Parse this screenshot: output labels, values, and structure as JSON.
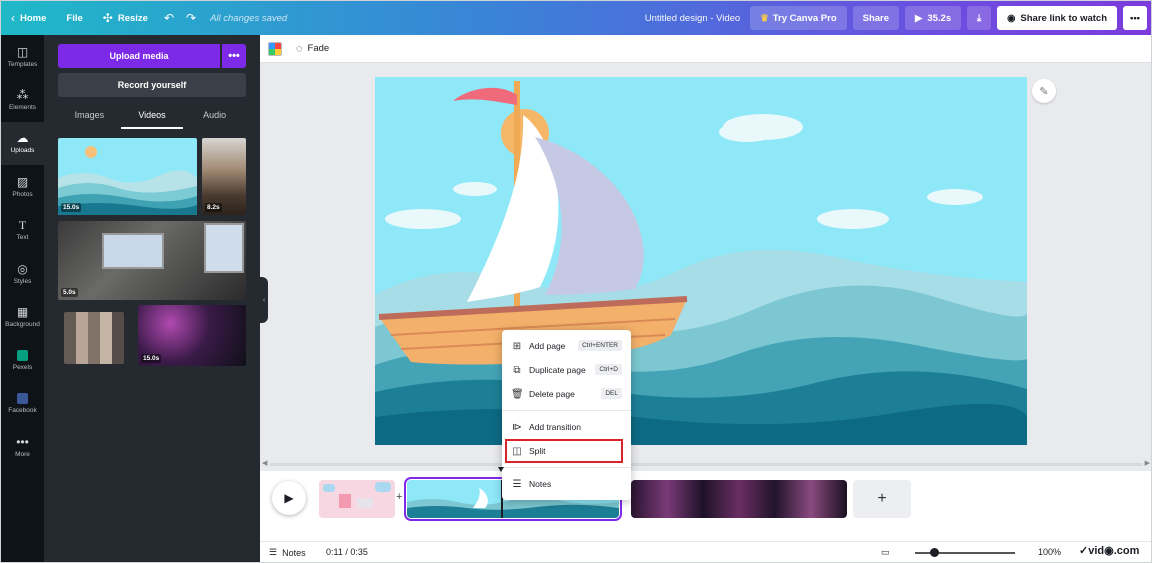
{
  "topbar": {
    "home": "Home",
    "file": "File",
    "resize": "Resize",
    "saved": "All changes saved",
    "title": "Untitled design - Video",
    "try_pro": "Try Canva Pro",
    "share": "Share",
    "duration": "35.2s",
    "share_link": "Share link to watch"
  },
  "rail": [
    {
      "label": "Templates",
      "icon": "templates-icon"
    },
    {
      "label": "Elements",
      "icon": "elements-icon"
    },
    {
      "label": "Uploads",
      "icon": "uploads-icon",
      "active": true
    },
    {
      "label": "Photos",
      "icon": "photos-icon"
    },
    {
      "label": "Text",
      "icon": "text-icon"
    },
    {
      "label": "Styles",
      "icon": "styles-icon"
    },
    {
      "label": "Background",
      "icon": "background-icon"
    },
    {
      "label": "Pexels",
      "icon": "pexels-icon"
    },
    {
      "label": "Facebook",
      "icon": "facebook-icon"
    },
    {
      "label": "More",
      "icon": "more-icon"
    }
  ],
  "panel": {
    "upload": "Upload media",
    "record": "Record yourself",
    "tabs": [
      "Images",
      "Videos",
      "Audio"
    ],
    "active_tab": "Videos",
    "videos": [
      {
        "duration": "15.0s"
      },
      {
        "duration": "8.2s"
      },
      {
        "duration": "5.0s"
      },
      {
        "duration": ""
      },
      {
        "duration": "15.0s"
      }
    ]
  },
  "toolbar": {
    "fade": "Fade"
  },
  "menu": {
    "items": [
      {
        "label": "Add page",
        "shortcut": "Ctrl+ENTER",
        "icon": "add-page-icon"
      },
      {
        "label": "Duplicate page",
        "shortcut": "Ctrl+D",
        "icon": "duplicate-icon"
      },
      {
        "label": "Delete page",
        "shortcut": "DEL",
        "icon": "trash-icon"
      },
      {
        "label": "Add transition",
        "shortcut": "",
        "icon": "transition-icon"
      },
      {
        "label": "Split",
        "shortcut": "",
        "icon": "split-icon",
        "highlighted": true
      },
      {
        "label": "Notes",
        "shortcut": "",
        "icon": "notes-icon"
      }
    ]
  },
  "bottombar": {
    "notes": "Notes",
    "time": "0:11 / 0:35",
    "zoom": "100%",
    "watermark": "✓vid◉.com"
  },
  "colors": {
    "accent": "#7d2ae8",
    "highlight": "#d8232a",
    "sky": "#8ee8f8"
  }
}
